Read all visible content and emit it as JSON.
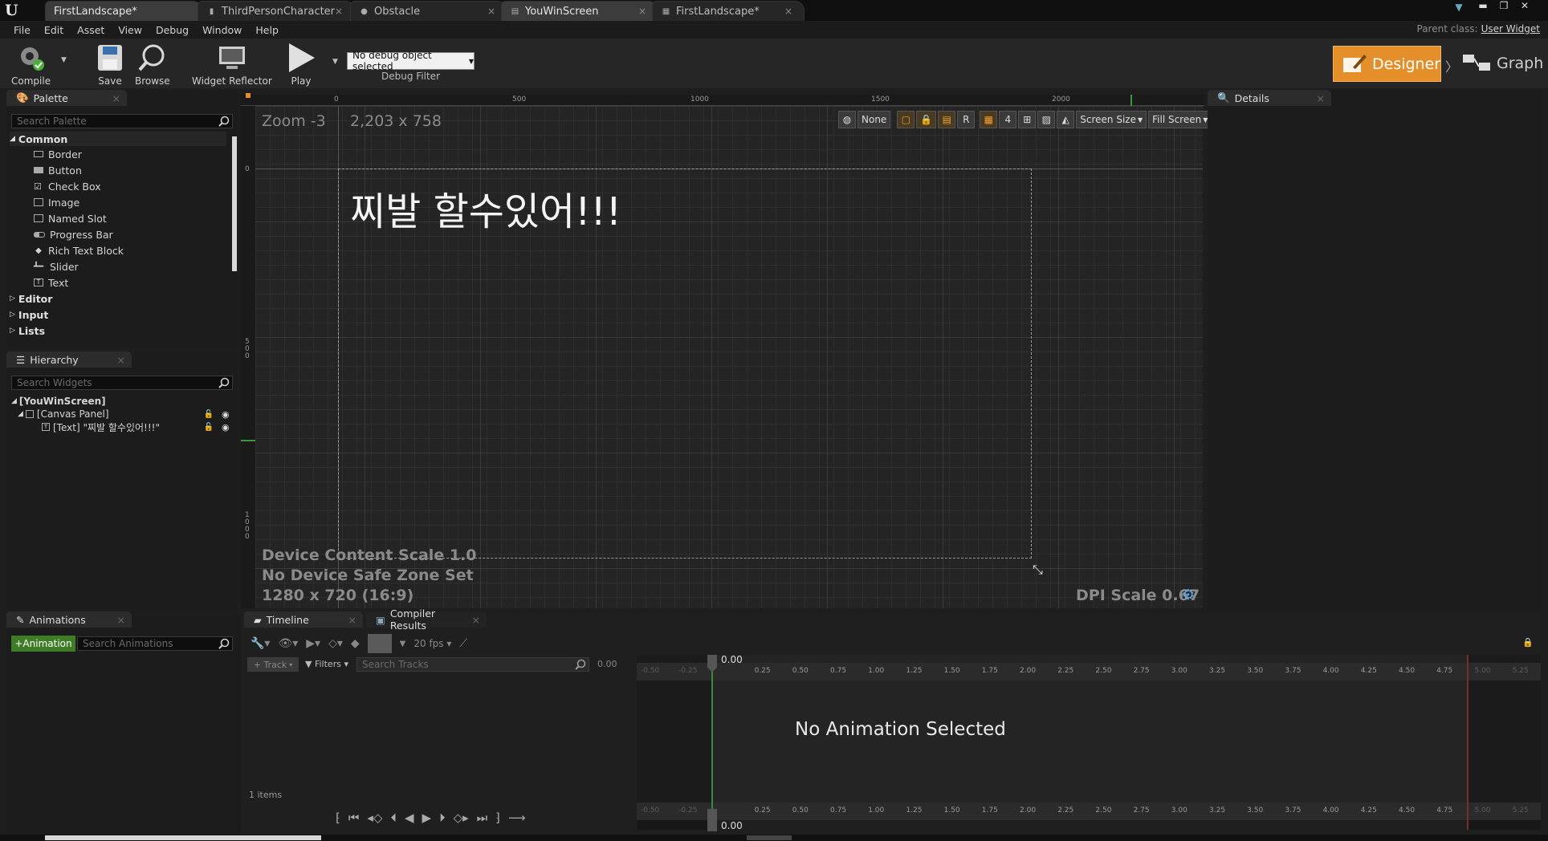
{
  "tabs": [
    {
      "label": "FirstLandscape*"
    },
    {
      "label": "ThirdPersonCharacter"
    },
    {
      "label": "Obstacle"
    },
    {
      "label": "YouWinScreen"
    },
    {
      "label": "FirstLandscape*"
    }
  ],
  "menu": [
    "File",
    "Edit",
    "Asset",
    "View",
    "Debug",
    "Window",
    "Help"
  ],
  "parent_class": {
    "label": "Parent class:",
    "value": "User Widget"
  },
  "toolbar": {
    "compile": "Compile",
    "save": "Save",
    "browse": "Browse",
    "widget_reflector": "Widget Reflector",
    "play": "Play",
    "debug_selected": "No debug object selected",
    "debug_filter": "Debug Filter",
    "designer": "Designer",
    "graph": "Graph"
  },
  "palette": {
    "title": "Palette",
    "search_placeholder": "Search Palette",
    "category_common": "Common",
    "items": [
      "Border",
      "Button",
      "Check Box",
      "Image",
      "Named Slot",
      "Progress Bar",
      "Rich Text Block",
      "Slider",
      "Text"
    ],
    "categories": [
      "Editor",
      "Input",
      "Lists"
    ]
  },
  "hierarchy": {
    "title": "Hierarchy",
    "search_placeholder": "Search Widgets",
    "root": "[YouWinScreen]",
    "canvas": "[Canvas Panel]",
    "text_item": "[Text] \"찌발 할수있어!!!\""
  },
  "viewport": {
    "zoom": "Zoom -3",
    "size": "2,203 x 758",
    "ruler_ticks": [
      "0",
      "500",
      "1000",
      "1500",
      "2000"
    ],
    "tool_none": "None",
    "tool_r": "R",
    "tool_4": "4",
    "screen_size": "Screen Size",
    "fill_screen": "Fill Screen",
    "widget_text": "찌발 할수있어!!!",
    "device_scale": "Device Content Scale 1.0",
    "safe_zone": "No Device Safe Zone Set",
    "resolution": "1280 x 720 (16:9)",
    "dpi": "DPI Scale 0.67"
  },
  "details": {
    "title": "Details"
  },
  "animations": {
    "title": "Animations",
    "add_button": "+Animation",
    "search_placeholder": "Search Animations"
  },
  "timeline": {
    "tab_timeline": "Timeline",
    "tab_compiler": "Compiler Results",
    "fps": "20 fps",
    "track": "+ Track",
    "filters": "Filters",
    "search_tracks": "Search Tracks",
    "time": "0.00",
    "playhead_label": "0.00",
    "items_count": "1 items",
    "no_animation": "No Animation Selected",
    "ruler": [
      "-0.50",
      "-0.25",
      "0.25",
      "0.50",
      "0.75",
      "1.00",
      "1.25",
      "1.50",
      "1.75",
      "2.00",
      "2.25",
      "2.50",
      "2.75",
      "3.00",
      "3.25",
      "3.50",
      "3.75",
      "4.00",
      "4.25",
      "4.50",
      "4.75",
      "5.00",
      "5.25"
    ]
  }
}
